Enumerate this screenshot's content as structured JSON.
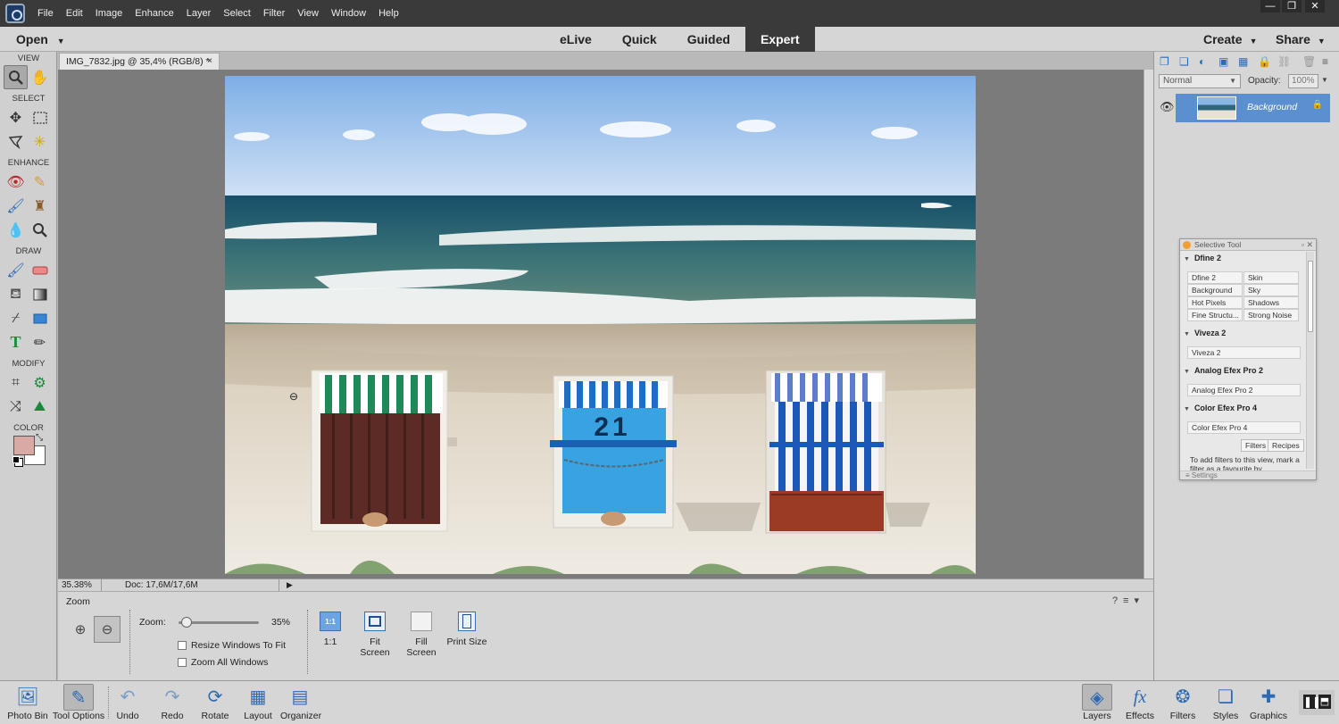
{
  "menubar": {
    "items": [
      "File",
      "Edit",
      "Image",
      "Enhance",
      "Layer",
      "Select",
      "Filter",
      "View",
      "Window",
      "Help"
    ],
    "window_controls": [
      "—",
      "❐",
      "✕"
    ]
  },
  "modebar": {
    "open_label": "Open",
    "modes": [
      "eLive",
      "Quick",
      "Guided",
      "Expert"
    ],
    "active_mode": "Expert",
    "create_label": "Create",
    "share_label": "Share"
  },
  "toolbox": {
    "sections": [
      "VIEW",
      "SELECT",
      "ENHANCE",
      "DRAW",
      "MODIFY",
      "COLOR"
    ],
    "colors": {
      "foreground": "#d9a9a4",
      "background": "#ffffff"
    }
  },
  "document": {
    "tab_title": "IMG_7832.jpg @ 35,4% (RGB/8) *",
    "tab_close": "×",
    "chair_number": "21"
  },
  "statusbar": {
    "zoom": "35.38%",
    "doc_size": "Doc: 17,6M/17,6M"
  },
  "tool_options": {
    "title": "Zoom",
    "zoom_label": "Zoom:",
    "zoom_value": "35%",
    "zoom_fraction": 0.35,
    "resize_windows": "Resize Windows To Fit",
    "zoom_all_windows": "Zoom All Windows",
    "one_to_one_icon": "1:1",
    "one_to_one": "1:1",
    "fit_screen": "Fit Screen",
    "fill_screen": "Fill Screen",
    "print_size": "Print Size"
  },
  "taskbar": {
    "photo_bin": "Photo Bin",
    "tool_options": "Tool Options",
    "undo": "Undo",
    "redo": "Redo",
    "rotate": "Rotate",
    "layout": "Layout",
    "organizer": "Organizer",
    "layers": "Layers",
    "effects": "Effects",
    "filters": "Filters",
    "styles": "Styles",
    "graphics": "Graphics"
  },
  "layers_panel": {
    "blend_mode": "Normal",
    "opacity_label": "Opacity:",
    "opacity_value": "100%",
    "layer_name": "Background"
  },
  "selective_tool": {
    "title": "Selective Tool",
    "dfine": {
      "name": "Dfine 2",
      "items": [
        "Dfine 2",
        "Skin",
        "Background",
        "Sky",
        "Hot Pixels",
        "Shadows",
        "Fine Structu...",
        "Strong Noise"
      ]
    },
    "viveza": {
      "name": "Viveza 2",
      "item": "Viveza 2"
    },
    "analog": {
      "name": "Analog Efex Pro 2",
      "item": "Analog Efex Pro 2"
    },
    "color": {
      "name": "Color Efex Pro 4",
      "item": "Color Efex Pro 4"
    },
    "tab_filters": "Filters",
    "tab_recipes": "Recipes",
    "info_text": "To add filters to this view, mark a filter as a favourite by",
    "settings": "Settings"
  }
}
